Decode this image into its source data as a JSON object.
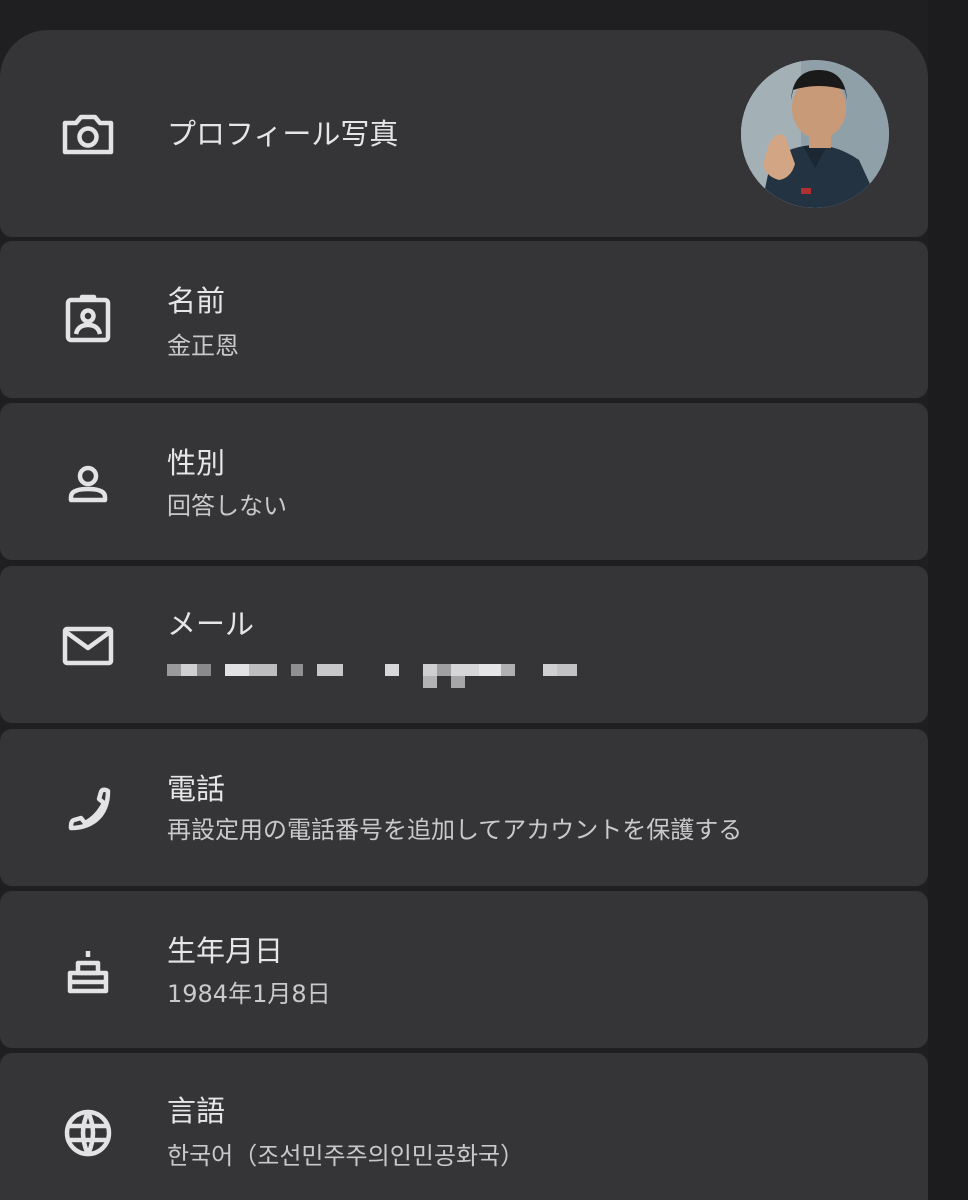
{
  "rows": {
    "photo": {
      "label": "プロフィール写真",
      "icon": "camera-icon"
    },
    "name": {
      "label": "名前",
      "value": "金正恩",
      "icon": "badge-icon"
    },
    "gender": {
      "label": "性別",
      "value": "回答しない",
      "icon": "person-icon"
    },
    "email": {
      "label": "メール",
      "value": "",
      "icon": "mail-icon"
    },
    "phone": {
      "label": "電話",
      "value": "再設定用の電話番号を追加してアカウントを保護する",
      "icon": "phone-icon"
    },
    "birthday": {
      "label": "生年月日",
      "value": "1984年1月8日",
      "icon": "cake-icon"
    },
    "language": {
      "label": "言語",
      "value": "한국어（조선민주주의인민공화국）",
      "icon": "globe-icon"
    }
  },
  "colors": {
    "background": "#1f1f21",
    "card": "#353537",
    "text_primary": "#e6e6e8",
    "text_secondary": "#c9c9cc",
    "icon": "#e3e3e6"
  }
}
